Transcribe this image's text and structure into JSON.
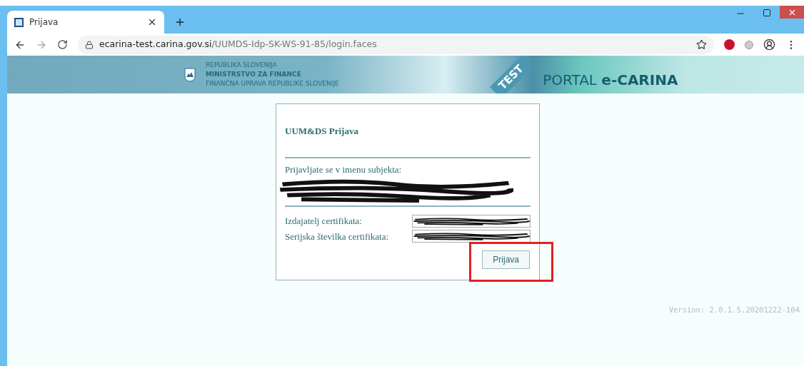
{
  "browser": {
    "tab": {
      "title": "Prijava",
      "selected": true
    },
    "address": {
      "domain": "ecarina-test.carina.gov.si",
      "path": "/UUMDS-Idp-SK-WS-91-85/login.faces"
    }
  },
  "banner": {
    "lines": [
      "REPUBLIKA SLOVENIJA",
      "MINISTRSTVO ZA FINANCE",
      "FINANČNA UPRAVA REPUBLIKE SLOVENIJE"
    ],
    "ribbon": "TEST",
    "portal": "PORTAL ",
    "portal_bold": "e-CARINA"
  },
  "login": {
    "title": "UUM&DS Prijava",
    "subject_label": "Prijavljate se v imenu subjekta:",
    "fields": [
      {
        "label": "Izdajatelj certifikata:"
      },
      {
        "label": "Serijska številka certifikata:"
      }
    ],
    "button": "Prijava"
  },
  "version": "Version: 2.0.1.5.20201222-104"
}
